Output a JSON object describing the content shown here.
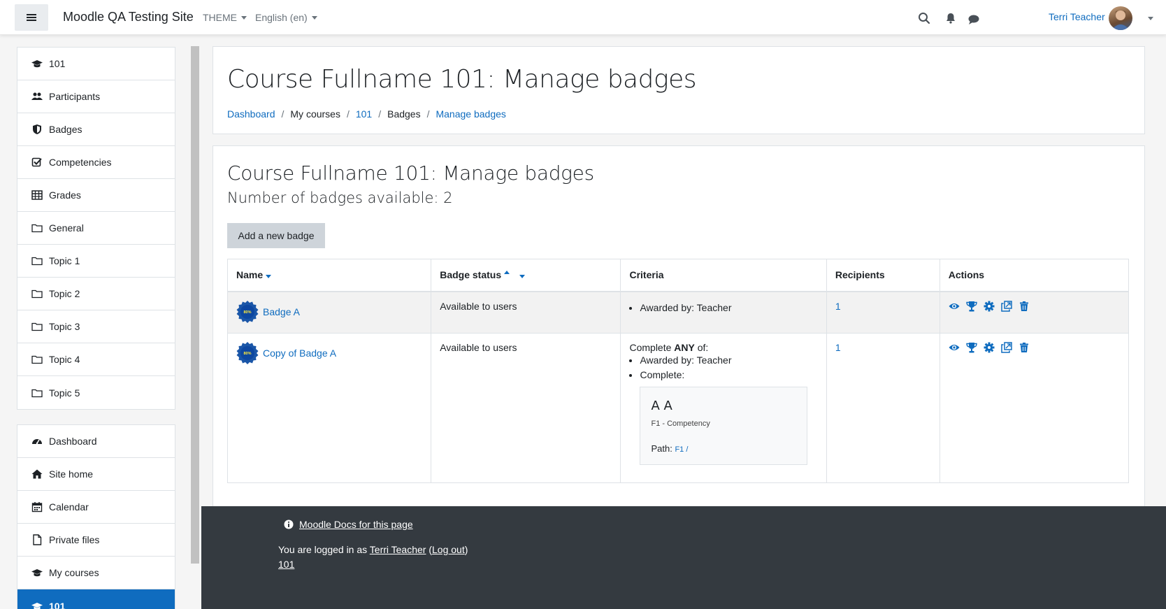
{
  "site": {
    "name": "Moodle QA Testing Site"
  },
  "navbar": {
    "theme_label": "THEME",
    "language_label": "English (en)",
    "user_name": "Terri Teacher"
  },
  "drawer": {
    "course_items": [
      {
        "label": "101",
        "icon": "graduation-cap-icon"
      },
      {
        "label": "Participants",
        "icon": "users-icon"
      },
      {
        "label": "Badges",
        "icon": "shield-icon"
      },
      {
        "label": "Competencies",
        "icon": "check-square-icon"
      },
      {
        "label": "Grades",
        "icon": "table-icon"
      },
      {
        "label": "General",
        "icon": "folder-icon"
      },
      {
        "label": "Topic 1",
        "icon": "folder-icon"
      },
      {
        "label": "Topic 2",
        "icon": "folder-icon"
      },
      {
        "label": "Topic 3",
        "icon": "folder-icon"
      },
      {
        "label": "Topic 4",
        "icon": "folder-icon"
      },
      {
        "label": "Topic 5",
        "icon": "folder-icon"
      }
    ],
    "site_items": [
      {
        "label": "Dashboard",
        "icon": "dashboard-icon"
      },
      {
        "label": "Site home",
        "icon": "home-icon"
      },
      {
        "label": "Calendar",
        "icon": "calendar-icon"
      },
      {
        "label": "Private files",
        "icon": "file-icon"
      },
      {
        "label": "My courses",
        "icon": "graduation-cap-icon"
      },
      {
        "label": "101",
        "icon": "graduation-cap-icon"
      }
    ]
  },
  "header": {
    "title": "Course Fullname 101: Manage badges",
    "breadcrumb": [
      "Dashboard",
      "My courses",
      "101",
      "Badges",
      "Manage badges"
    ]
  },
  "content": {
    "title": "Course Fullname 101: Manage badges",
    "count_text": "Number of badges available: 2",
    "add_button": "Add a new badge",
    "table": {
      "headers": [
        "Name",
        "Badge status",
        "Criteria",
        "Recipients",
        "Actions"
      ],
      "badge_image_text": "80%",
      "rows": [
        {
          "name": "Badge A",
          "status": "Available to users",
          "criteria": [
            "Awarded by: Teacher"
          ],
          "recipients": "1"
        },
        {
          "name": "Copy of Badge A",
          "status": "Available to users",
          "criteria_intro_pre": "Complete ",
          "criteria_intro_bold": "ANY",
          "criteria_intro_post": " of:",
          "criteria": [
            "Awarded by: Teacher",
            "Complete:"
          ],
          "competency": {
            "name": "A A",
            "description": "F1 - Competency",
            "path_label": "Path:",
            "path_link": "F1 /"
          },
          "recipients": "1"
        }
      ],
      "action_icons": [
        "eye-icon",
        "trophy-icon",
        "gear-icon",
        "copy-icon",
        "trash-icon"
      ]
    }
  },
  "footer": {
    "docs_link": "Moodle Docs for this page",
    "logged_in_prefix": "You are logged in as ",
    "user_link": "Terri Teacher",
    "open_paren": " (",
    "logout_link": "Log out",
    "close_paren": ")",
    "course_link": "101"
  },
  "colors": {
    "primary": "#0f6cbf",
    "footer_bg": "#343a40",
    "button_bg": "#ced4da"
  }
}
